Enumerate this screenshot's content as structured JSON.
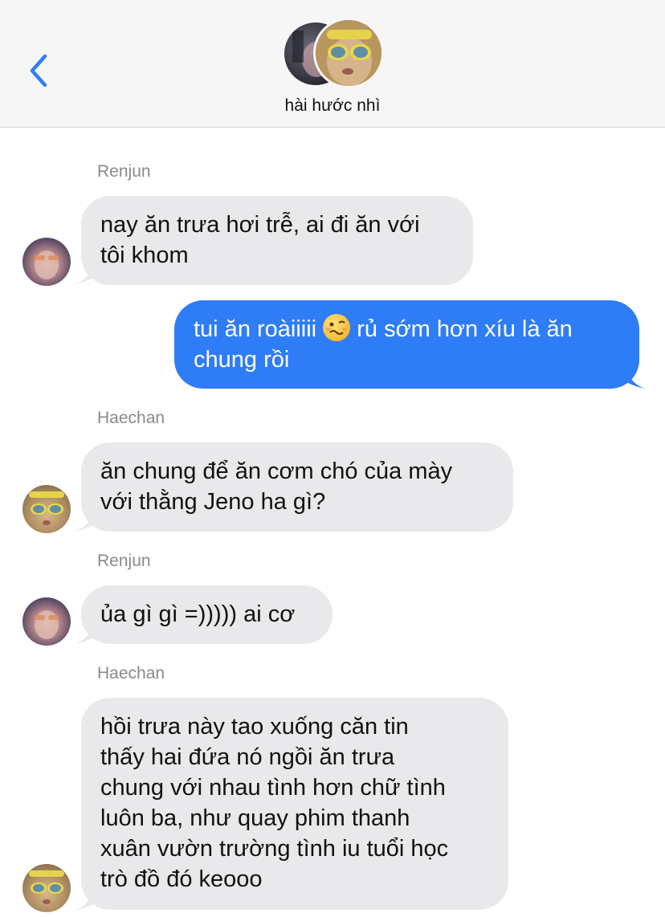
{
  "header": {
    "title": "hài hước nhì"
  },
  "messages": [
    {
      "sender": "Renjun",
      "text": "nay ăn trưa hơi trễ, ai đi ăn với\ntôi khom",
      "direction": "in"
    },
    {
      "text_before_emoji": "tui ăn roàiiiii ",
      "emoji": "woozy-face",
      "text_after_emoji": " rủ sớm hơn xíu là ăn\nchung rồi",
      "direction": "out"
    },
    {
      "sender": "Haechan",
      "text": "ăn chung để ăn cơm chó của mày\nvới thằng Jeno ha gì?",
      "direction": "in"
    },
    {
      "sender": "Renjun",
      "text": "ủa gì gì =))))) ai cơ",
      "direction": "in"
    },
    {
      "sender": "Haechan",
      "text": "hồi trưa này tao xuống căn tin\nthấy hai đứa nó ngồi ăn trưa\nchung với nhau tình hơn chữ tình\nluôn ba, như quay phim thanh\nxuân vườn trường tình iu tuổi học\ntrò đồ đó keooo",
      "direction": "in"
    }
  ],
  "colors": {
    "incoming_bubble": "#e9e9eb",
    "outgoing_bubble": "#2f7df6",
    "accent": "#2f7df6",
    "sender_label": "#8a8a8e"
  },
  "icons": {
    "back": "chevron-left-icon",
    "group_avatar": "group-avatar"
  }
}
